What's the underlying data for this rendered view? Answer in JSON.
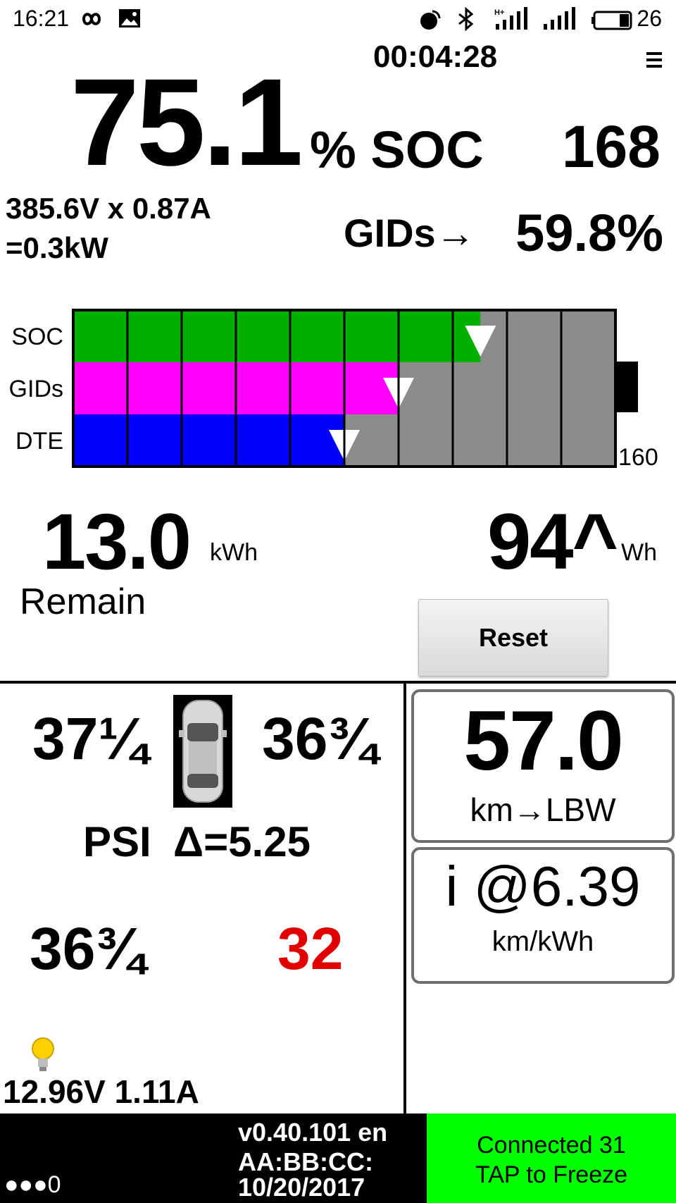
{
  "status_bar": {
    "time": "16:21",
    "battery_pct": "26",
    "icons": [
      "infinity-icon",
      "image-icon",
      "location-icon",
      "bluetooth-icon",
      "signal-icon",
      "signal-icon",
      "battery-icon"
    ]
  },
  "header": {
    "timer": "00:04:28",
    "soc_value": "75.1",
    "soc_unit": "% SOC",
    "soc_right_value": "168",
    "power_line1": "385.6V x 0.87A",
    "power_line2": "=0.3kW",
    "gids_label": "GIDs→",
    "gids_pct": "59.8%"
  },
  "bars": {
    "rows": [
      {
        "label": "SOC",
        "value_pct": 75.1,
        "color": "#00b000"
      },
      {
        "label": "GIDs",
        "value_pct": 60.0,
        "color": "#ff00ff"
      },
      {
        "label": "DTE",
        "value_pct": 50.0,
        "color": "#0000ff"
      }
    ],
    "background": "#8c8c8c",
    "scale_end_label": "160"
  },
  "energy": {
    "remain_value": "13.0",
    "remain_unit": "kWh",
    "remain_label": "Remain",
    "wh_value": "94^",
    "wh_unit": "Wh",
    "reset_label": "Reset"
  },
  "tires": {
    "front_left": "37¼",
    "front_right": "36¾",
    "rear_left": "36¾",
    "rear_right": "32",
    "rear_right_color": "#e00000",
    "psi_label": "PSI",
    "delta": "Δ=5.25"
  },
  "aux": {
    "power": "12.96V 1.11A"
  },
  "panels": {
    "range_value": "57.0",
    "range_unit": "km→LBW",
    "eff_value": "i @6.39",
    "eff_unit": "km/kWh"
  },
  "footer": {
    "dots": "●●●0",
    "version": "v0.40.101 en",
    "mac": "AA:BB:CC:",
    "date": "10/20/2017",
    "connected": "Connected 31",
    "tap": "TAP to Freeze",
    "green": "#00ff00"
  }
}
